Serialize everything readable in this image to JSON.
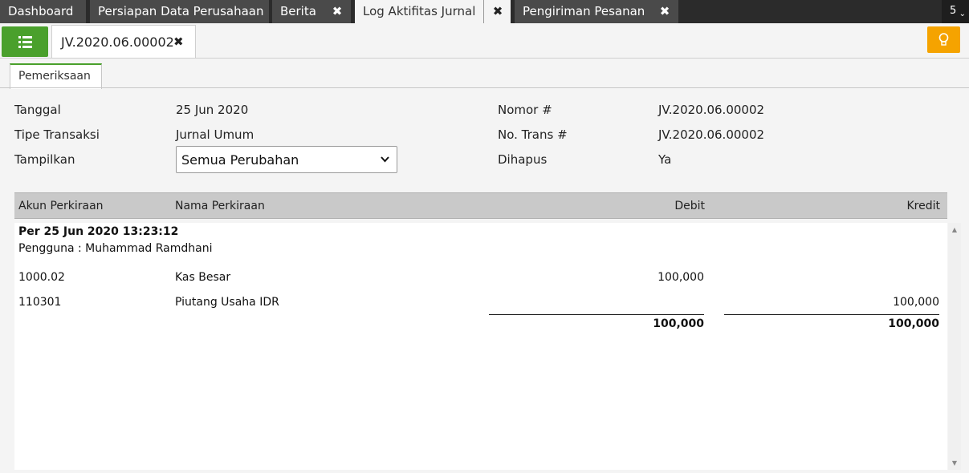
{
  "top_tabs": [
    {
      "label": "Dashboard"
    },
    {
      "label": "Persiapan Data Perusahaan"
    },
    {
      "label": "Berita"
    },
    {
      "label": "Log Aktifitas Jurnal"
    },
    {
      "label": "Pengiriman Pesanan"
    }
  ],
  "tab_count": "5",
  "doc_tab": {
    "label": "JV.2020.06.00002"
  },
  "sub_tab": {
    "label": "Pemeriksaan"
  },
  "form": {
    "tanggal_label": "Tanggal",
    "tanggal_value": "25 Jun 2020",
    "tipe_label": "Tipe Transaksi",
    "tipe_value": "Jurnal Umum",
    "tampilkan_label": "Tampilkan",
    "tampilkan_value": "Semua Perubahan",
    "nomor_label": "Nomor #",
    "nomor_value": "JV.2020.06.00002",
    "notrans_label": "No. Trans #",
    "notrans_value": "JV.2020.06.00002",
    "dihapus_label": "Dihapus",
    "dihapus_value": "Ya"
  },
  "grid": {
    "columns": [
      "Akun Perkiraan",
      "Nama Perkiraan",
      "Debit",
      "Kredit"
    ],
    "group_header": "Per 25 Jun 2020 13:23:12",
    "group_user": "Pengguna : Muhammad Ramdhani",
    "rows": [
      {
        "akun": "1000.02",
        "nama": "Kas Besar",
        "debit": "100,000",
        "kredit": ""
      },
      {
        "akun": "110301",
        "nama": "Piutang Usaha IDR",
        "debit": "",
        "kredit": "100,000"
      }
    ],
    "total_debit": "100,000",
    "total_kredit": "100,000"
  },
  "colors": {
    "accent_green": "#4aa02c",
    "accent_orange": "#f5a300",
    "tabbar": "#2b2b2b"
  }
}
